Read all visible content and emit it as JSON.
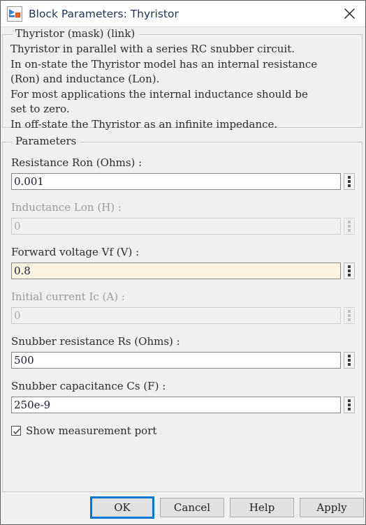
{
  "window": {
    "title": "Block Parameters: Thyristor",
    "icon": "simulink-block-icon",
    "close_icon": "close-icon"
  },
  "description_group": {
    "legend": "Thyristor (mask) (link)",
    "body": "Thyristor in parallel with a series RC snubber circuit.\nIn on-state the Thyristor model has an internal resistance\n(Ron) and inductance (Lon).\nFor most applications the internal inductance should be\nset to zero.\nIn off-state the Thyristor as an infinite impedance."
  },
  "parameters_group": {
    "legend": "Parameters",
    "fields": [
      {
        "name": "resistance-ron",
        "label": "Resistance Ron (Ohms) :",
        "value": "0.001",
        "placeholder": "",
        "disabled": false,
        "focused": false,
        "spinner_icon": "vertical-dots-icon"
      },
      {
        "name": "inductance-lon",
        "label": "Inductance Lon (H) :",
        "value": "0",
        "placeholder": "",
        "disabled": true,
        "focused": false,
        "spinner_icon": "vertical-dots-icon"
      },
      {
        "name": "forward-voltage-vf",
        "label": "Forward voltage Vf (V) :",
        "value": "0.8",
        "placeholder": "",
        "disabled": false,
        "focused": true,
        "spinner_icon": "vertical-dots-icon"
      },
      {
        "name": "initial-current-ic",
        "label": "Initial current Ic (A) :",
        "value": "0",
        "placeholder": "",
        "disabled": true,
        "focused": false,
        "spinner_icon": "vertical-dots-icon"
      },
      {
        "name": "snubber-resistance-rs",
        "label": "Snubber resistance Rs (Ohms) :",
        "value": "500",
        "placeholder": "",
        "disabled": false,
        "focused": false,
        "spinner_icon": "vertical-dots-icon"
      },
      {
        "name": "snubber-capacitance-cs",
        "label": "Snubber capacitance Cs (F) :",
        "value": "250e-9",
        "placeholder": "",
        "disabled": false,
        "focused": false,
        "spinner_icon": "vertical-dots-icon"
      }
    ],
    "checkbox": {
      "name": "show-measurement-port",
      "label": "Show measurement port",
      "checked": true
    }
  },
  "buttons": [
    {
      "name": "ok-button",
      "label": "OK",
      "default": true
    },
    {
      "name": "cancel-button",
      "label": "Cancel",
      "default": false
    },
    {
      "name": "help-button",
      "label": "Help",
      "default": false
    },
    {
      "name": "apply-button",
      "label": "Apply",
      "default": false
    }
  ],
  "colors": {
    "dialog_bg": "#f0f0f0",
    "titlebar_bg": "#ffffff",
    "title_text": "#1d3557",
    "focus_field_bg": "#fdf3e1",
    "default_button_border": "#0078d7",
    "group_border": "#c8c8c8",
    "disabled_text": "#9a9a9a"
  }
}
